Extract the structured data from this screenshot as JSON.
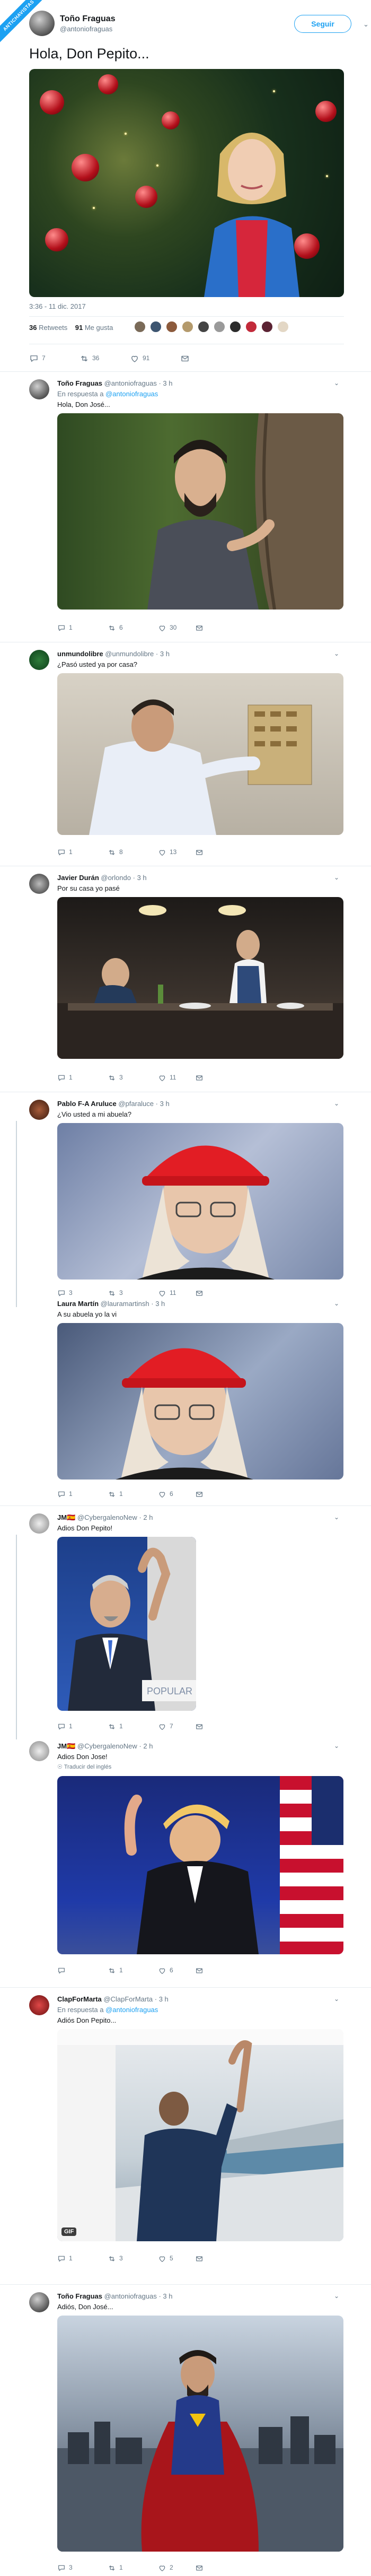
{
  "badge": "ANTICHAVISTAS",
  "main_tweet": {
    "author_name": "Toño Fraguas",
    "author_handle": "@antoniofraguas",
    "follow_label": "Seguir",
    "text": "Hola, Don Pepito...",
    "timestamp": "3:36 - 11 dic. 2017",
    "retweets_count": "36",
    "retweets_label": "Retweets",
    "likes_count": "91",
    "likes_label": "Me gusta",
    "actions": {
      "replies": "7",
      "retweets": "36",
      "likes": "91"
    }
  },
  "replies": [
    {
      "name": "Toño Fraguas",
      "handle": "@antoniofraguas",
      "time": "3 h",
      "reply_prefix": "En respuesta a",
      "reply_to": "@antoniofraguas",
      "text": "Hola, Don José...",
      "actions": {
        "replies": "1",
        "retweets": "6",
        "likes": "30"
      }
    },
    {
      "name": "unmundolibre",
      "handle": "@unmundolibre",
      "time": "3 h",
      "text": "¿Pasó usted ya por casa?",
      "actions": {
        "replies": "1",
        "retweets": "8",
        "likes": "13"
      }
    },
    {
      "name": "Javier Durán",
      "handle": "@orlondo",
      "time": "3 h",
      "text": "Por su casa yo pasé",
      "actions": {
        "replies": "1",
        "retweets": "3",
        "likes": "11"
      }
    },
    {
      "name": "Pablo F-A Aruluce",
      "handle": "@pfaraluce",
      "time": "3 h",
      "text": "¿Vio usted a mi abuela?",
      "actions": {
        "replies": "3",
        "retweets": "3",
        "likes": "11"
      }
    },
    {
      "name": "Laura Martín",
      "handle": "@lauramartinsh",
      "time": "3 h",
      "text": "A su abuela yo la vi",
      "actions": {
        "replies": "1",
        "retweets": "1",
        "likes": "6"
      }
    },
    {
      "name": "JM🇪🇸",
      "handle": "@CybergalenoNew",
      "time": "2 h",
      "text": "Adios Don Pepito!",
      "image_text": "POPULAR",
      "actions": {
        "replies": "1",
        "retweets": "1",
        "likes": "7"
      }
    },
    {
      "name": "JM🇪🇸",
      "handle": "@CybergalenoNew",
      "time": "2 h",
      "text": "Adios Don Jose!",
      "translate": "Traducir del inglés",
      "actions": {
        "replies": "",
        "retweets": "1",
        "likes": "6"
      }
    },
    {
      "name": "ClapForMarta",
      "handle": "@ClapForMarta",
      "time": "3 h",
      "reply_prefix": "En respuesta a",
      "reply_to": "@antoniofraguas",
      "text": "Adiós Don Pepito...",
      "gif_label": "GIF",
      "actions": {
        "replies": "1",
        "retweets": "3",
        "likes": "5"
      }
    },
    {
      "name": "Toño Fraguas",
      "handle": "@antoniofraguas",
      "time": "3 h",
      "text": "Adiós, Don José...",
      "actions": {
        "replies": "3",
        "retweets": "1",
        "likes": "2"
      }
    }
  ],
  "colors": {
    "accent": "#1da1f2",
    "muted": "#657786",
    "border": "#e6ecf0"
  }
}
